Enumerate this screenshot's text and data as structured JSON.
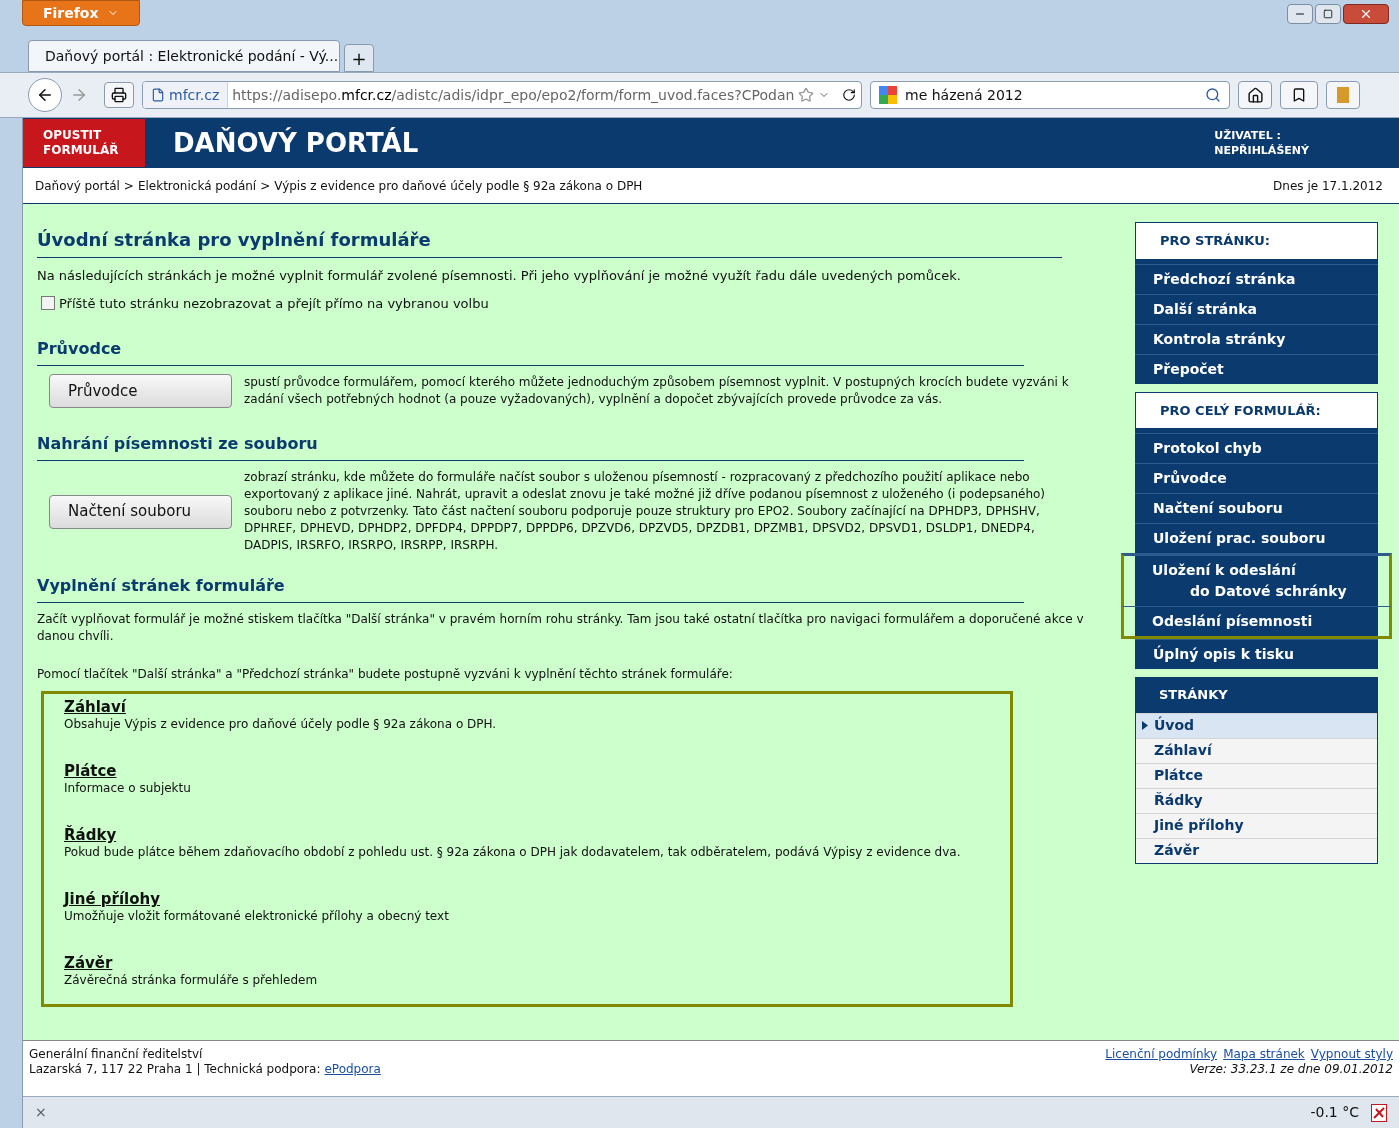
{
  "browser": {
    "app_button": "Firefox",
    "tab_title": "Daňový portál : Elektronické podání - Vý...",
    "new_tab": "+",
    "url_domain": "mfcr.cz",
    "url_prefix": "https://adisepo.",
    "url_host": "mfcr.cz",
    "url_path": "/adistc/adis/idpr_epo/epo2/form/form_uvod.faces?CPodan",
    "search_value": "me házená 2012"
  },
  "header": {
    "exit_button": "OPUSTIT FORMULÁŘ",
    "title": "DAŇOVÝ PORTÁL",
    "user_label": "UŽIVATEL :",
    "user_value": "NEPŘIHLÁŠENÝ"
  },
  "breadcrumb": {
    "items": [
      "Daňový portál",
      "Elektronická podání",
      "Výpis z evidence pro daňové účely podle § 92a zákona o DPH"
    ],
    "separator": ">",
    "date": "Dnes je 17.1.2012"
  },
  "main": {
    "title": "Úvodní stránka pro vyplnění formuláře",
    "intro": "Na následujících stránkách je možné vyplnit formulář zvolené písemnosti. Při jeho vyplňování je možné využít řadu dále uvedených pomůcek.",
    "skip_checkbox": {
      "label": "Příště tuto stránku nezobrazovat a přejít přímo na vybranou volbu",
      "checked": false
    },
    "sections": [
      {
        "title": "Průvodce",
        "button": "Průvodce",
        "text": "spustí průvodce formulářem, pomocí kterého můžete jednoduchým způsobem písemnost vyplnit. V postupných krocích budete vyzváni k zadání všech potřebných hodnot (a pouze vyžadovaných), vyplnění a dopočet zbývajících provede průvodce za vás."
      },
      {
        "title": "Nahrání písemnosti ze souboru",
        "button": "Načtení souboru",
        "text": "zobrazí stránku, kde můžete do formuláře načíst soubor s uloženou písemností - rozpracovaný z předchozího použití aplikace nebo exportovaný z aplikace jiné. Nahrát, upravit a odeslat znovu je také možné již dříve podanou písemnost z uloženého (i podepsaného) souboru nebo z potvrzenky. Tato část načtení souboru podporuje pouze struktury pro EPO2. Soubory začínající na DPHDP3, DPHSHV, DPHREF, DPHEVD, DPHDP2, DPFDP4, DPPDP7, DPPDP6, DPZVD6, DPZVD5, DPZDB1, DPZMB1, DPSVD2, DPSVD1, DSLDP1, DNEDP4, DADPIS, IRSRFO, IRSRPO, IRSRPP, IRSRPH."
      }
    ],
    "fill_title": "Vyplnění stránek formuláře",
    "fill_text": "Začít vyplňovat formulář je možné stiskem tlačítka \"Další stránka\" v pravém horním rohu stránky. Tam jsou také ostatní tlačítka pro navigaci formulářem a doporučené akce v danou chvíli.",
    "fill_text2": "Pomocí tlačítek \"Další stránka\" a \"Předchozí stránka\" budete postupně vyzváni k vyplnění těchto stránek formuláře:",
    "pages": [
      {
        "name": "Záhlaví",
        "description": "Obsahuje Výpis z evidence pro daňové účely podle § 92a zákona o DPH."
      },
      {
        "name": "Plátce",
        "description": "Informace o subjektu"
      },
      {
        "name": "Řádky",
        "description": "Pokud bude plátce během zdaňovacího období z pohledu ust. § 92a zákona o DPH jak dodavatelem, tak odběratelem, podává Výpisy z evidence dva."
      },
      {
        "name": "Jiné přílohy",
        "description": "Umožňuje vložit formátované elektronické přílohy a obecný text"
      },
      {
        "name": "Závěr",
        "description": "Závěrečná stránka formuláře s přehledem"
      }
    ]
  },
  "sidebar": {
    "page_actions": {
      "title": "PRO STRÁNKU:",
      "items": [
        {
          "label": "Předchozí stránka",
          "highlighted": false
        },
        {
          "label": "Další stránka",
          "highlighted": false
        },
        {
          "label": "Kontrola stránky",
          "highlighted": false
        },
        {
          "label": "Přepočet",
          "highlighted": false
        }
      ]
    },
    "form_actions": {
      "title": "PRO CELÝ FORMULÁŘ:",
      "items": [
        {
          "label": "Protokol chyb",
          "highlighted": false
        },
        {
          "label": "Průvodce",
          "highlighted": false
        },
        {
          "label": "Načtení souboru",
          "highlighted": false
        },
        {
          "label": "Uložení prac. souboru",
          "highlighted": false
        },
        {
          "label": "Uložení k odeslání",
          "label2": "do Datové schránky",
          "highlighted": true
        },
        {
          "label": "Odeslání písemnosti",
          "highlighted": true
        },
        {
          "label": "Úplný opis k tisku",
          "highlighted": false
        }
      ]
    },
    "pages": {
      "title": "STRÁNKY",
      "items": [
        {
          "label": "Úvod",
          "selected": true
        },
        {
          "label": "Záhlaví",
          "selected": false
        },
        {
          "label": "Plátce",
          "selected": false
        },
        {
          "label": "Řádky",
          "selected": false
        },
        {
          "label": "Jiné přílohy",
          "selected": false
        },
        {
          "label": "Závěr",
          "selected": false
        }
      ]
    }
  },
  "footer": {
    "org": "Generální finanční ředitelství",
    "address": "Lazarská 7, 117 22 Praha 1 | Technická podpora:",
    "support_link": "ePodpora",
    "links": [
      "Licenční podmínky",
      "Mapa stránek",
      "Vypnout styly"
    ],
    "version": "Verze: 33.23.1 ze dne 09.01.2012"
  },
  "status_bar": {
    "close": "×",
    "temperature": "-0.1 °C"
  }
}
